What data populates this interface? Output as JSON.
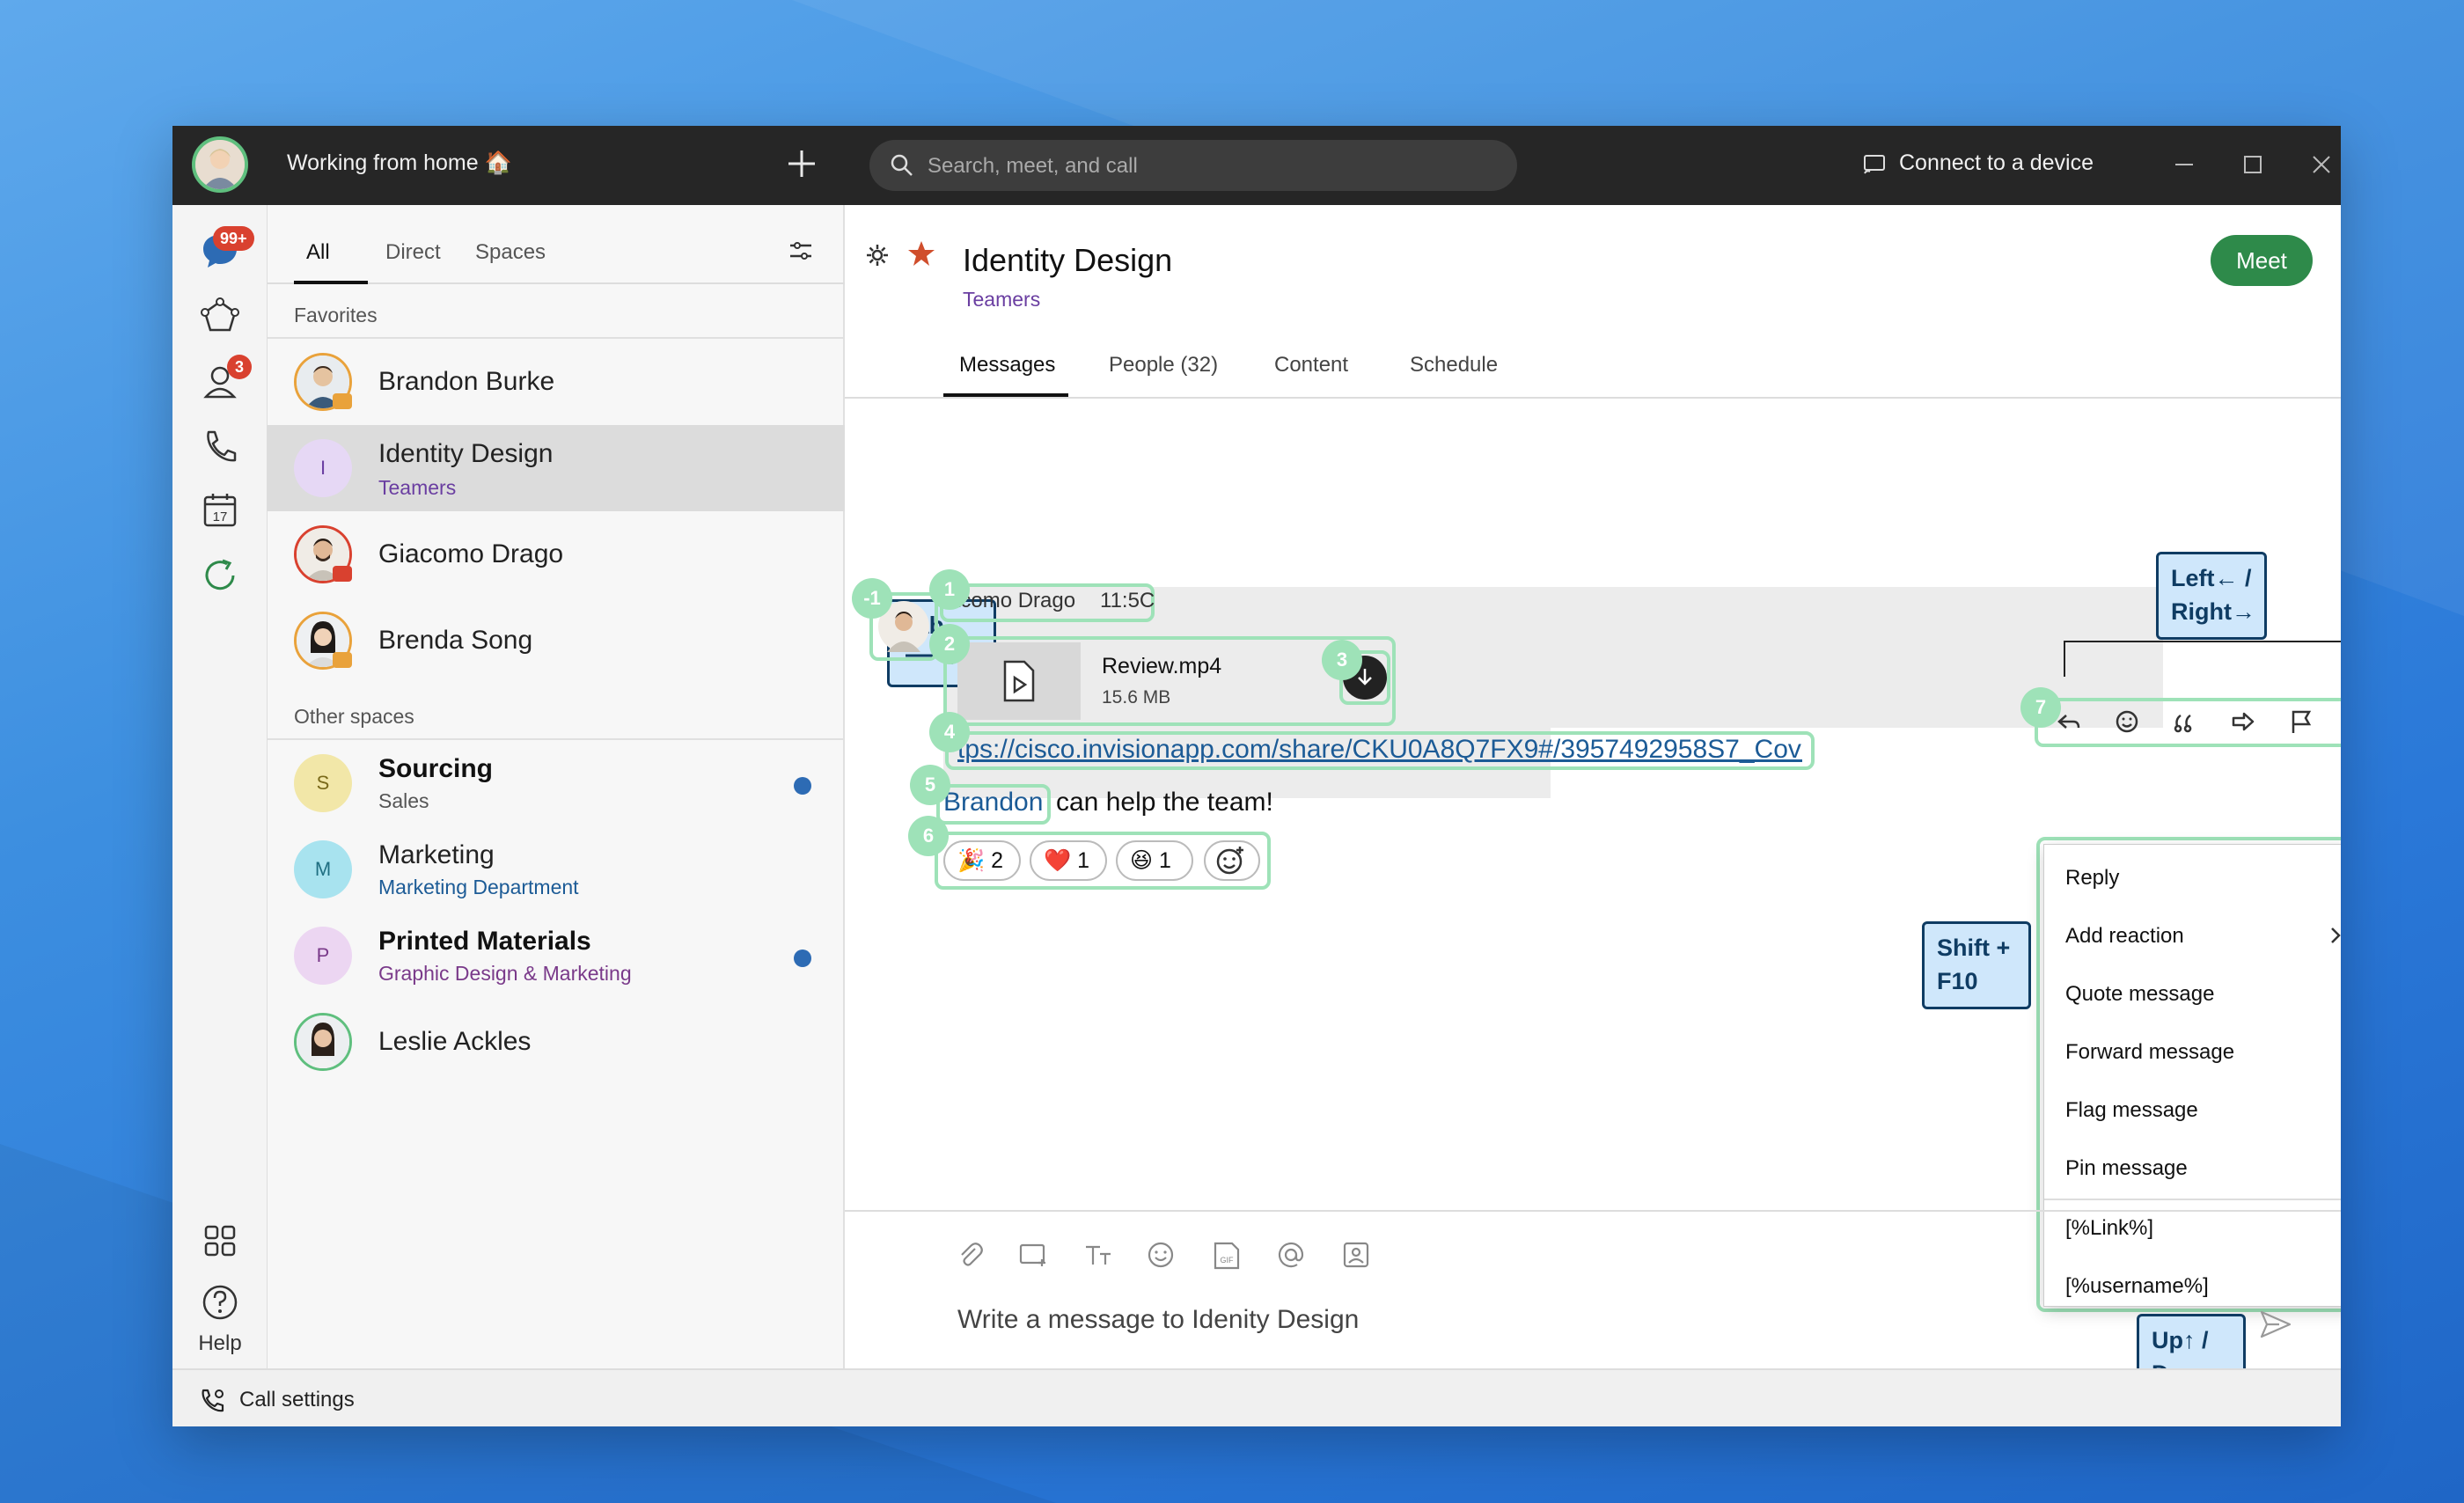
{
  "titlebar": {
    "status": "Working from home 🏠",
    "search_placeholder": "Search, meet, and call",
    "connect": "Connect to a device"
  },
  "rail": {
    "messages_badge": "99+",
    "contacts_badge": "3",
    "calendar_day": "17",
    "help": "Help"
  },
  "list": {
    "tabs": [
      "All",
      "Direct",
      "Spaces"
    ],
    "favorites_label": "Favorites",
    "other_label": "Other spaces",
    "favorites": [
      {
        "name": "Brandon Burke"
      },
      {
        "name": "Identity Design",
        "sub": "Teamers",
        "initial": "I"
      },
      {
        "name": "Giacomo Drago"
      },
      {
        "name": "Brenda Song"
      }
    ],
    "others": [
      {
        "name": "Sourcing",
        "sub": "Sales",
        "initial": "S"
      },
      {
        "name": "Marketing",
        "sub": "Marketing Department",
        "initial": "M"
      },
      {
        "name": "Printed Materials",
        "sub": "Graphic Design & Marketing",
        "initial": "P"
      },
      {
        "name": "Leslie Ackles"
      }
    ]
  },
  "space": {
    "title": "Identity Design",
    "team": "Teamers",
    "meet": "Meet",
    "tabs": [
      "Messages",
      "People (32)",
      "Content",
      "Schedule"
    ]
  },
  "message": {
    "sender": "acomo Drago",
    "time": "11:5C",
    "file_name": "Review.mp4",
    "file_size": "15.6 MB",
    "link": "tps://cisco.invisionapp.com/share/CKU0A8Q7FX9#/3957492958S7_Cover",
    "mention": "Brandon",
    "text": "can help the team!",
    "reactions": [
      {
        "emoji": "🎉",
        "count": "2"
      },
      {
        "emoji": "❤️",
        "count": "1"
      },
      {
        "emoji": "😆",
        "count": "1"
      }
    ]
  },
  "annotations": {
    "nums": [
      "-1",
      "1",
      "2",
      "3",
      "4",
      "5",
      "6",
      "7"
    ],
    "tab_key": "Tab",
    "left_right_1": "Left← /",
    "left_right_2": "Right→",
    "shift_1": "Shift +",
    "shift_2": "F10",
    "updown_1": "Up↑ /",
    "updown_2": "Down↓"
  },
  "context_menu": {
    "items": [
      "Reply",
      "Add reaction",
      "Quote message",
      "Forward message",
      "Flag message",
      "Pin message",
      "[%Link%]",
      "[%username%]"
    ]
  },
  "composer": {
    "placeholder": "Write a message to Idenity Design"
  },
  "statusbar": {
    "call_settings": "Call settings"
  },
  "colors": {
    "accent_green": "#2e8a4a",
    "highlight": "#9ee2b8",
    "badge_red": "#d9412f",
    "team_purple": "#6a3ea1",
    "link_blue": "#1c5b96"
  }
}
